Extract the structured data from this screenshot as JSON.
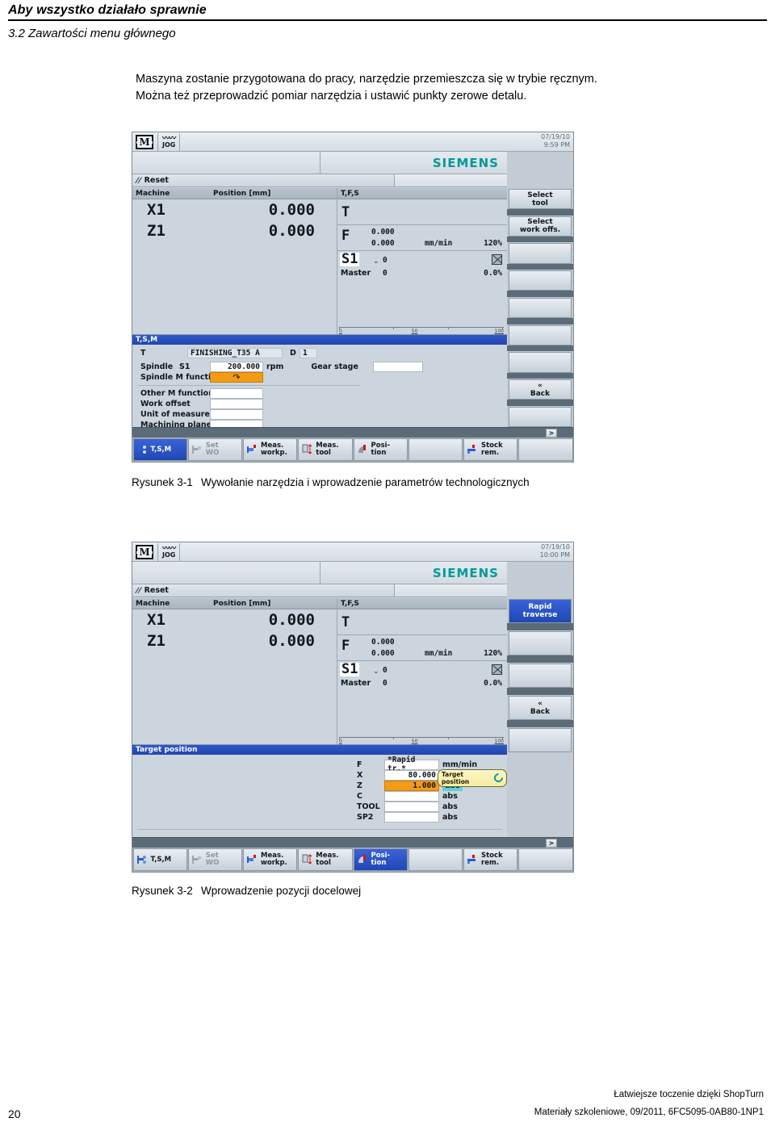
{
  "header": {
    "title": "Aby wszystko działało sprawnie",
    "section": "3.2 Zawartości menu głównego"
  },
  "paragraph": {
    "line1": "Maszyna zostanie przygotowana do pracy, narzędzie przemieszcza się w trybie ręcznym.",
    "line2": "Można też przeprowadzić pomiar narzędzia i ustawić punkty zerowe detalu."
  },
  "captions": {
    "fig1_num": "Rysunek 3-1",
    "fig1_text": "Wywołanie narzędzia i wprowadzenie parametrów technologicznych",
    "fig2_num": "Rysunek 3-2",
    "fig2_text": "Wprowadzenie pozycji docelowej"
  },
  "figure1": {
    "status": {
      "mode_icon": "machine-m-icon",
      "mode_letter": "M",
      "jog_label": "JOG",
      "date": "07/19/10",
      "time": "9:59 PM"
    },
    "brand": "SIEMENS",
    "alarm": {
      "icon": "reset-icon",
      "text": "Reset"
    },
    "position": {
      "col_axis": "Machine",
      "col_value": "Position [mm]",
      "rows": [
        {
          "axis": "X1",
          "value": "0.000"
        },
        {
          "axis": "Z1",
          "value": "0.000"
        }
      ]
    },
    "tfs": {
      "header": "T,F,S",
      "t_label": "T",
      "t_value": "",
      "f_label": "F",
      "f_actual": "0.000",
      "f_set": "0.000",
      "f_unit": "mm/min",
      "f_override": "120%",
      "s_label": "S1",
      "s_actual": "0",
      "s_master_label": "Master",
      "s_master_value": "0",
      "s_override": "0.0%",
      "scale_ticks": [
        "0",
        "50",
        "100"
      ]
    },
    "dialog": {
      "title": "T,S,M",
      "t_label": "T",
      "t_value": "FINISHING_T35 A",
      "d_label": "D",
      "d_value": "1",
      "spindle_label": "Spindle",
      "spindle_axis": "S1",
      "spindle_value": "200.000",
      "spindle_unit": "rpm",
      "gear_label": "Gear stage",
      "gear_value": "",
      "spindle_m_label": "Spindle M function",
      "spindle_m_value": "↷",
      "other_m_label": "Other M function",
      "other_m_value": "",
      "work_offset_label": "Work offset",
      "work_offset_value": "",
      "unit_label": "Unit of measure.",
      "unit_value": "",
      "plane_label": "Machining plane",
      "plane_value": ""
    },
    "vertical_softkeys": [
      {
        "label": "Select\ntool",
        "active": false
      },
      {
        "label": "Select\nwork offs.",
        "active": false
      },
      {
        "label": "",
        "active": false
      },
      {
        "label": "",
        "active": false
      },
      {
        "label": "",
        "active": false
      },
      {
        "label": "",
        "active": false
      },
      {
        "label": "",
        "active": false
      },
      {
        "label": "«\nBack",
        "active": false
      },
      {
        "label": "",
        "active": false
      }
    ],
    "etc_key": ">",
    "horizontal_softkeys": [
      {
        "label": "T,S,M",
        "icon": "tsm-icon",
        "active": true,
        "dim": false
      },
      {
        "label": "Set\nWO",
        "icon": "set-wo-icon",
        "active": false,
        "dim": true
      },
      {
        "label": "Meas.\nworkp.",
        "icon": "measure-workpiece-icon",
        "active": false,
        "dim": false
      },
      {
        "label": "Meas.\ntool",
        "icon": "measure-tool-icon",
        "active": false,
        "dim": false
      },
      {
        "label": "Posi-\ntion",
        "icon": "position-icon",
        "active": false,
        "dim": false
      },
      {
        "label": "",
        "icon": "",
        "active": false,
        "dim": false
      },
      {
        "label": "Stock\nrem.",
        "icon": "stock-removal-icon",
        "active": false,
        "dim": false
      },
      {
        "label": "",
        "icon": "",
        "active": false,
        "dim": false
      }
    ]
  },
  "figure2": {
    "status": {
      "mode_letter": "M",
      "jog_label": "JOG",
      "date": "07/19/10",
      "time": "10:00 PM"
    },
    "brand": "SIEMENS",
    "alarm": {
      "text": "Reset"
    },
    "position": {
      "col_axis": "Machine",
      "col_value": "Position [mm]",
      "rows": [
        {
          "axis": "X1",
          "value": "0.000"
        },
        {
          "axis": "Z1",
          "value": "0.000"
        }
      ]
    },
    "tfs": {
      "header": "T,F,S",
      "t_label": "T",
      "f_label": "F",
      "f_actual": "0.000",
      "f_set": "0.000",
      "f_unit": "mm/min",
      "f_override": "120%",
      "s_label": "S1",
      "s_actual": "0",
      "s_master_label": "Master",
      "s_master_value": "0",
      "s_override": "0.0%",
      "scale_ticks": [
        "0",
        "50",
        "100"
      ]
    },
    "dialog": {
      "title": "Target position",
      "rows": [
        {
          "label": "F",
          "value": "*Rapid tr.*",
          "unit": "mm/min",
          "orange": false,
          "center": true
        },
        {
          "label": "X",
          "value": "80.000",
          "unit": "abs",
          "orange": false,
          "center": false
        },
        {
          "label": "Z",
          "value": "1.000",
          "unit": "abs",
          "orange": true,
          "center": false
        },
        {
          "label": "C",
          "value": "",
          "unit": "abs",
          "orange": false,
          "center": false
        },
        {
          "label": "TOOL",
          "value": "",
          "unit": "abs",
          "orange": false,
          "center": false
        },
        {
          "label": "SP2",
          "value": "",
          "unit": "abs",
          "orange": false,
          "center": false
        }
      ],
      "tooltip": "Target position",
      "tooltip_icon": "rotate-circle-icon"
    },
    "vertical_softkeys": [
      {
        "label": "Rapid\ntraverse",
        "active": true
      },
      {
        "label": "",
        "active": false
      },
      {
        "label": "",
        "active": false
      },
      {
        "label": "«\nBack",
        "active": false
      },
      {
        "label": "",
        "active": false
      }
    ],
    "etc_key": ">",
    "horizontal_softkeys": [
      {
        "label": "T,S,M",
        "icon": "tsm-icon",
        "active": false,
        "dim": false
      },
      {
        "label": "Set\nWO",
        "icon": "set-wo-icon",
        "active": false,
        "dim": true
      },
      {
        "label": "Meas.\nworkp.",
        "icon": "measure-workpiece-icon",
        "active": false,
        "dim": false
      },
      {
        "label": "Meas.\ntool",
        "icon": "measure-tool-icon",
        "active": false,
        "dim": false
      },
      {
        "label": "Posi-\ntion",
        "icon": "position-icon",
        "active": true,
        "dim": false
      },
      {
        "label": "",
        "icon": "",
        "active": false,
        "dim": false
      },
      {
        "label": "Stock\nrem.",
        "icon": "stock-removal-icon",
        "active": false,
        "dim": false
      },
      {
        "label": "",
        "icon": "",
        "active": false,
        "dim": false
      }
    ]
  },
  "footer": {
    "page": "20",
    "line1": "Łatwiejsze toczenie dzięki ShopTurn",
    "line2": "Materiały szkoleniowe, 09/2011, 6FC5095-0AB80-1NP1"
  },
  "colors": {
    "brand_teal": "#009999",
    "dialog_blue": "#2246ae",
    "orange_field": "#f59a15",
    "softkey_active": "#1f47b4"
  }
}
